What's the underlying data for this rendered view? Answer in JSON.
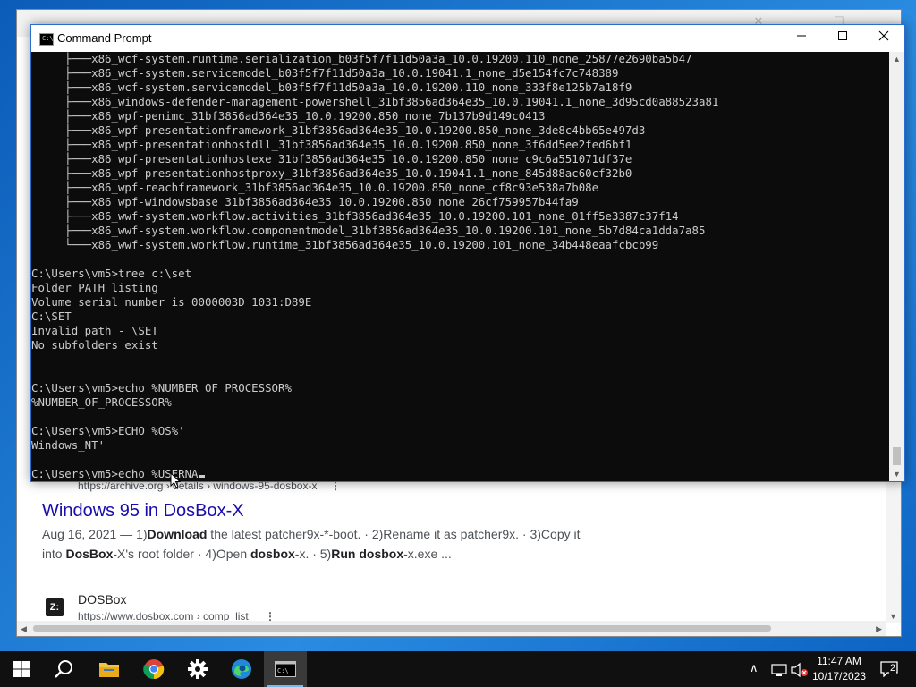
{
  "browser": {
    "result1": {
      "url": "https://archive.org › details › windows-95-dosbox-x",
      "title": "Windows 95 in DosBox-X",
      "date": "Aug 16, 2021 — ",
      "snippet_parts": [
        "1)",
        "Download",
        " the latest patcher9x-*-boot. · 2)Rename it as patcher9x. · 3)Copy it into ",
        "DosBox",
        "-X's root folder · 4)Open ",
        "dosbox",
        "-x. · 5)",
        "Run dosbox",
        "-x.exe ..."
      ]
    },
    "result2": {
      "site_name": "DOSBox",
      "url": "https://www.dosbox.com › comp_list",
      "icon_text": "Z:"
    }
  },
  "cmd": {
    "title": "Command Prompt",
    "lines": [
      "     ├───x86_wcf-system.runtime.serialization_b03f5f7f11d50a3a_10.0.19200.110_none_25877e2690ba5b47",
      "     ├───x86_wcf-system.servicemodel_b03f5f7f11d50a3a_10.0.19041.1_none_d5e154fc7c748389",
      "     ├───x86_wcf-system.servicemodel_b03f5f7f11d50a3a_10.0.19200.110_none_333f8e125b7a18f9",
      "     ├───x86_windows-defender-management-powershell_31bf3856ad364e35_10.0.19041.1_none_3d95cd0a88523a81",
      "     ├───x86_wpf-penimc_31bf3856ad364e35_10.0.19200.850_none_7b137b9d149c0413",
      "     ├───x86_wpf-presentationframework_31bf3856ad364e35_10.0.19200.850_none_3de8c4bb65e497d3",
      "     ├───x86_wpf-presentationhostdll_31bf3856ad364e35_10.0.19200.850_none_3f6dd5ee2fed6bf1",
      "     ├───x86_wpf-presentationhostexe_31bf3856ad364e35_10.0.19200.850_none_c9c6a551071df37e",
      "     ├───x86_wpf-presentationhostproxy_31bf3856ad364e35_10.0.19041.1_none_845d88ac60cf32b0",
      "     ├───x86_wpf-reachframework_31bf3856ad364e35_10.0.19200.850_none_cf8c93e538a7b08e",
      "     ├───x86_wpf-windowsbase_31bf3856ad364e35_10.0.19200.850_none_26cf759957b44fa9",
      "     ├───x86_wwf-system.workflow.activities_31bf3856ad364e35_10.0.19200.101_none_01ff5e3387c37f14",
      "     ├───x86_wwf-system.workflow.componentmodel_31bf3856ad364e35_10.0.19200.101_none_5b7d84ca1dda7a85",
      "     └───x86_wwf-system.workflow.runtime_31bf3856ad364e35_10.0.19200.101_none_34b448eaafcbcb99",
      "",
      "C:\\Users\\vm5>tree c:\\set",
      "Folder PATH listing",
      "Volume serial number is 0000003D 1031:D89E",
      "C:\\SET",
      "Invalid path - \\SET",
      "No subfolders exist",
      "",
      "",
      "C:\\Users\\vm5>echo %NUMBER_OF_PROCESSOR%",
      "%NUMBER_OF_PROCESSOR%",
      "",
      "C:\\Users\\vm5>ECHO %OS%'",
      "Windows_NT'",
      "",
      "C:\\Users\\vm5>echo %USERNA"
    ]
  },
  "taskbar": {
    "time": "11:47 AM",
    "date": "10/17/2023",
    "notification_count": "2"
  }
}
